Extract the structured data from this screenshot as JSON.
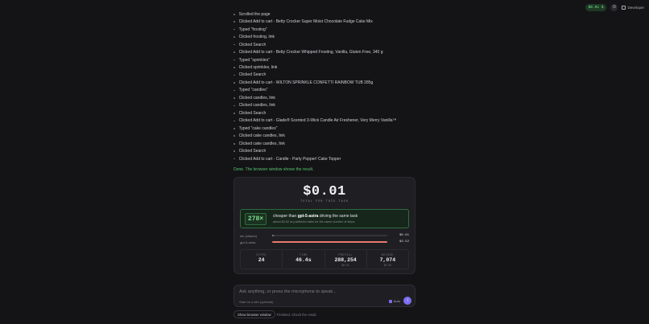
{
  "topbar": {
    "cost_pill": "$0.01 $",
    "settings_icon": "gear-icon",
    "developer_label": "Developer"
  },
  "steps": [
    "Scrolled the page",
    "Clicked Add to cart - Betty Crocker Super Moist Chocolate Fudge Cake Mix",
    "Typed \"frosting\"",
    "Clicked frosting, link",
    "Clicked Search",
    "Clicked Add to cart - Betty Crocker Whipped Frosting, Vanilla, Gluten Free, 340 g",
    "Typed \"sprinkles\"",
    "Clicked sprinkles, link",
    "Clicked Search",
    "Clicked Add to cart - WILTON SPRINKLE CONFETTI RAINBOW TUB 285g",
    "Typed \"candles\"",
    "Clicked candles, link",
    "Clicked candles, link",
    "Clicked Search",
    "Clicked Add to cart - Glade® Scented 3-Wick Candle Air Freshener, Very Merry Vanilla™",
    "Typed \"cake candles\"",
    "Clicked cake candles, link",
    "Clicked cake candles, link",
    "Clicked Search",
    "Clicked Add to cart - Candle - Party Popper! Cake Topper"
  ],
  "done_message": "Done. The browser window shows the result.",
  "summary": {
    "total": "$0.01",
    "total_label": "TOTAL FOR THIS TASK",
    "multiplier": "278×",
    "cheaper_prefix": "cheaper than ",
    "cheaper_model": "gpt-5-astra",
    "cheaper_suffix": " driving the same task",
    "cheaper_sub": "about $3.52 at published rates for the same number of steps",
    "bars": [
      {
        "name": "ian (ollama)",
        "value": "$0.01",
        "fraction": 0.004,
        "color": "#8a8a92"
      },
      {
        "name": "gpt-5-astra",
        "value": "$3.52",
        "fraction": 1.0,
        "color": "#e8796a"
      }
    ],
    "stats": [
      {
        "label": "STEPS",
        "value": "24",
        "sub": ""
      },
      {
        "label": "TIME",
        "value": "46.4s",
        "sub": ""
      },
      {
        "label": "PREFILL",
        "value": "288,254",
        "sub": "$0.01"
      },
      {
        "label": "DECODE",
        "value": "7,074",
        "sub": "$0.00"
      }
    ]
  },
  "input": {
    "placeholder": "Ask anything, or press the microphone to speak...",
    "site_link": "Start on a site (optional)",
    "auto_label": "Auto",
    "send_icon": "arrow-up-icon"
  },
  "footer": {
    "show_browser": "Show browser window",
    "status": "Finished. Check the result."
  }
}
